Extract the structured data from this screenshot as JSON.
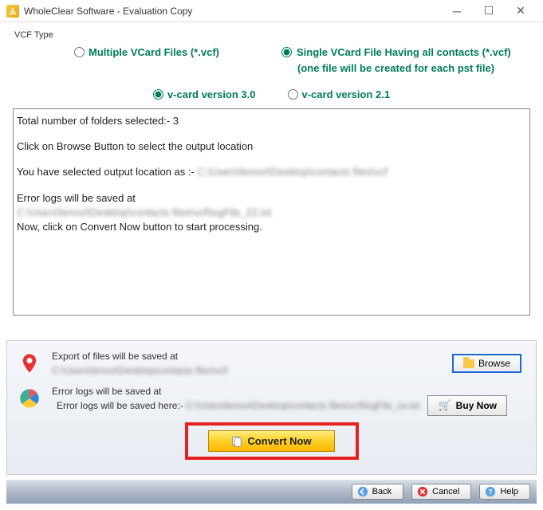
{
  "title": "WholeClear Software - Evaluation Copy",
  "vcfTypeLabel": "VCF Type",
  "radios": {
    "multiple": "Multiple VCard Files (*.vcf)",
    "singleLine1": "Single VCard File Having all contacts (*.vcf)",
    "singleLine2": "(one file will be created for each pst file)",
    "v30": "v-card version 3.0",
    "v21": "v-card version 2.1"
  },
  "log": {
    "l1": "Total number of folders selected:- 3",
    "l2": "Click on Browse Button to select the output location",
    "l3a": "You have selected output location as :- ",
    "l3b": "C:\\Users\\lenovi\\Desktop\\contacts files\\vcf",
    "l4a": "Error logs will be saved at",
    "l4b": "C:\\Users\\lenovi\\Desktop\\contacts files\\vcf\\logFile_22.txt",
    "l5": "Now, click on Convert Now button to start processing."
  },
  "export": {
    "title": "Export of files will be saved at",
    "path": "C:\\Users\\lenovi\\Desktop\\contacts files\\vcf",
    "browse": "Browse"
  },
  "errlog": {
    "title": "Error logs will be saved at",
    "prefix": "Error logs will be saved here:- ",
    "path": "C:\\Users\\lenovi\\Desktop\\contacts files\\vcf\\logFile_xx.txt"
  },
  "buttons": {
    "convert": "Convert Now",
    "buy": "Buy Now",
    "back": "Back",
    "cancel": "Cancel",
    "help": "Help"
  }
}
